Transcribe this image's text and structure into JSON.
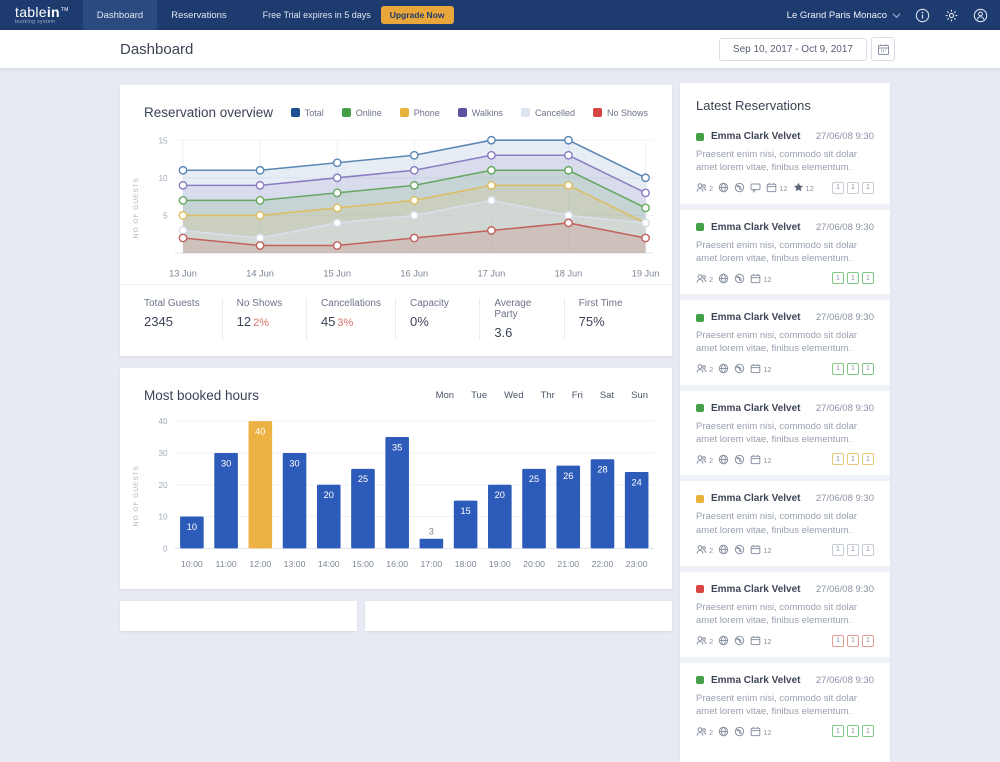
{
  "nav": {
    "logo": {
      "part1": "table",
      "part2": "in",
      "tm": "TM",
      "tagline": "booking system"
    },
    "tabs": [
      {
        "label": "Dashboard",
        "active": true
      },
      {
        "label": "Reservations",
        "active": false
      }
    ],
    "trial_text": "Free Trial expires in 5 days",
    "upgrade_label": "Upgrade Now",
    "account": "Le Grand Paris Monaco",
    "icons": [
      "chevron-down",
      "info",
      "gear",
      "user"
    ]
  },
  "header": {
    "title": "Dashboard",
    "date_range": "Sep 10, 2017 - Oct 9, 2017"
  },
  "reservation_overview": {
    "title": "Reservation overview",
    "legend": [
      {
        "label": "Total",
        "color": "#1d4f91"
      },
      {
        "label": "Online",
        "color": "#43a047"
      },
      {
        "label": "Phone",
        "color": "#e8b33c"
      },
      {
        "label": "Walkins",
        "color": "#5e52a0"
      },
      {
        "label": "Cancelled",
        "color": "#dde3f0"
      },
      {
        "label": "No Shows",
        "color": "#d64541"
      }
    ],
    "chart_data": {
      "type": "line",
      "x": [
        "13 Jun",
        "14 Jun",
        "15 Jun",
        "16 Jun",
        "17 Jun",
        "18 Jun",
        "19 Jun"
      ],
      "ylabel": "NO OF GUESTS",
      "ylim": [
        0,
        16
      ],
      "yticks": [
        5,
        10,
        15
      ],
      "grid": true,
      "series": [
        {
          "name": "Total",
          "color": "#5a87b5",
          "fill_opacity": 0.15,
          "values": [
            11,
            11,
            12,
            13,
            15,
            15,
            10
          ]
        },
        {
          "name": "Walkins",
          "color": "#8a7dc1",
          "fill_opacity": 0.15,
          "values": [
            9,
            9,
            10,
            11,
            13,
            13,
            8
          ]
        },
        {
          "name": "Online",
          "color": "#67a761",
          "fill_opacity": 0.15,
          "values": [
            7,
            7,
            8,
            9,
            11,
            11,
            6
          ]
        },
        {
          "name": "Phone",
          "color": "#ddbd60",
          "fill_opacity": 0.18,
          "values": [
            5,
            5,
            6,
            7,
            9,
            9,
            4
          ]
        },
        {
          "name": "Cancelled",
          "color": "#d9dfec",
          "fill_opacity": 0.45,
          "values": [
            3,
            2,
            4,
            5,
            7,
            5,
            4
          ]
        },
        {
          "name": "No Shows",
          "color": "#c2625d",
          "fill_opacity": 0.2,
          "values": [
            2,
            1,
            1,
            2,
            3,
            4,
            2
          ]
        }
      ]
    },
    "stats": [
      {
        "label": "Total Guests",
        "value": "2345",
        "pct": ""
      },
      {
        "label": "No Shows",
        "value": "12",
        "pct": "2%"
      },
      {
        "label": "Cancellations",
        "value": "45",
        "pct": "3%"
      },
      {
        "label": "Capacity",
        "value": "0%",
        "pct": ""
      },
      {
        "label": "Average Party",
        "value": "3.6",
        "pct": ""
      },
      {
        "label": "First Time",
        "value": "75%",
        "pct": ""
      }
    ],
    "pct_color": "#d9736c"
  },
  "most_booked": {
    "title": "Most booked hours",
    "day_tabs": [
      "Mon",
      "Tue",
      "Wed",
      "Thr",
      "Fri",
      "Sat",
      "Sun"
    ],
    "chart_data": {
      "type": "bar",
      "categories": [
        "10:00",
        "11:00",
        "12:00",
        "13:00",
        "14:00",
        "15:00",
        "16:00",
        "17:00",
        "18:00",
        "19:00",
        "20:00",
        "21:00",
        "22:00",
        "23:00"
      ],
      "values": [
        10,
        30,
        40,
        30,
        20,
        25,
        35,
        3,
        15,
        20,
        25,
        26,
        28,
        24
      ],
      "highlight_index": 2,
      "bar_color": "#2d5bb9",
      "highlight_color": "#ecb244",
      "ylabel": "NO OF GUESTS",
      "yticks": [
        0,
        10,
        20,
        30,
        40
      ],
      "ylim": [
        0,
        40
      ],
      "grid": true
    }
  },
  "latest_reservations": {
    "title": "Latest Reservations",
    "items": [
      {
        "status": "#43a047",
        "name": "Emma Clark Velvet",
        "datetime": "27/06/08 9:30",
        "note": "Praesent enim nisi, commodo sit dolar amet lorem vitae, finibus elementum.",
        "meta": [
          {
            "icon": "users",
            "value": "2"
          },
          {
            "icon": "globe",
            "value": ""
          },
          {
            "icon": "phone",
            "value": ""
          },
          {
            "icon": "comment",
            "value": ""
          },
          {
            "icon": "calendar",
            "value": "12"
          },
          {
            "icon": "star",
            "value": "12"
          }
        ],
        "tables": [
          "1",
          "1",
          "1"
        ],
        "table_color": "#c4cad6"
      },
      {
        "status": "#43a047",
        "name": "Emma Clark Velvet",
        "datetime": "27/06/08 9:30",
        "note": "Praesent enim nisi, commodo sit dolar amet lorem vitae, finibus elementum.",
        "meta": [
          {
            "icon": "users",
            "value": "2"
          },
          {
            "icon": "globe",
            "value": ""
          },
          {
            "icon": "phone",
            "value": ""
          },
          {
            "icon": "calendar",
            "value": "12"
          }
        ],
        "tables": [
          "1",
          "1",
          "1"
        ],
        "table_color": "#81c784"
      },
      {
        "status": "#43a047",
        "name": "Emma Clark Velvet",
        "datetime": "27/06/08 9:30",
        "note": "Praesent enim nisi, commodo sit dolar amet lorem vitae, finibus elementum.",
        "meta": [
          {
            "icon": "users",
            "value": "2"
          },
          {
            "icon": "globe",
            "value": ""
          },
          {
            "icon": "phone",
            "value": ""
          },
          {
            "icon": "calendar",
            "value": "12"
          }
        ],
        "tables": [
          "1",
          "1",
          "1"
        ],
        "table_color": "#81c784"
      },
      {
        "status": "#43a047",
        "name": "Emma Clark Velvet",
        "datetime": "27/06/08 9:30",
        "note": "Praesent enim nisi, commodo sit dolar amet lorem vitae, finibus elementum.",
        "meta": [
          {
            "icon": "users",
            "value": "2"
          },
          {
            "icon": "globe",
            "value": ""
          },
          {
            "icon": "phone",
            "value": ""
          },
          {
            "icon": "calendar",
            "value": "12"
          }
        ],
        "tables": [
          "1",
          "1",
          "1"
        ],
        "table_color": "#e6c878"
      },
      {
        "status": "#e8b33c",
        "name": "Emma Clark Velvet",
        "datetime": "27/06/08 9:30",
        "note": "Praesent enim nisi, commodo sit dolar amet lorem vitae, finibus elementum.",
        "meta": [
          {
            "icon": "users",
            "value": "2"
          },
          {
            "icon": "globe",
            "value": ""
          },
          {
            "icon": "phone",
            "value": ""
          },
          {
            "icon": "calendar",
            "value": "12"
          }
        ],
        "tables": [
          "1",
          "1",
          "1"
        ],
        "table_color": "#c4cad6"
      },
      {
        "status": "#d64541",
        "name": "Emma Clark Velvet",
        "datetime": "27/06/08 9:30",
        "note": "Praesent enim nisi, commodo sit dolar amet lorem vitae, finibus elementum.",
        "meta": [
          {
            "icon": "users",
            "value": "2"
          },
          {
            "icon": "globe",
            "value": ""
          },
          {
            "icon": "phone",
            "value": ""
          },
          {
            "icon": "calendar",
            "value": "12"
          }
        ],
        "tables": [
          "1",
          "1",
          "1"
        ],
        "table_color": "#e19c93"
      },
      {
        "status": "#43a047",
        "name": "Emma Clark Velvet",
        "datetime": "27/06/08 9:30",
        "note": "Praesent enim nisi, commodo sit dolar amet lorem vitae, finibus elementum.",
        "meta": [
          {
            "icon": "users",
            "value": "2"
          },
          {
            "icon": "globe",
            "value": ""
          },
          {
            "icon": "phone",
            "value": ""
          },
          {
            "icon": "calendar",
            "value": "12"
          }
        ],
        "tables": [
          "1",
          "1",
          "1"
        ],
        "table_color": "#81c784"
      }
    ]
  }
}
